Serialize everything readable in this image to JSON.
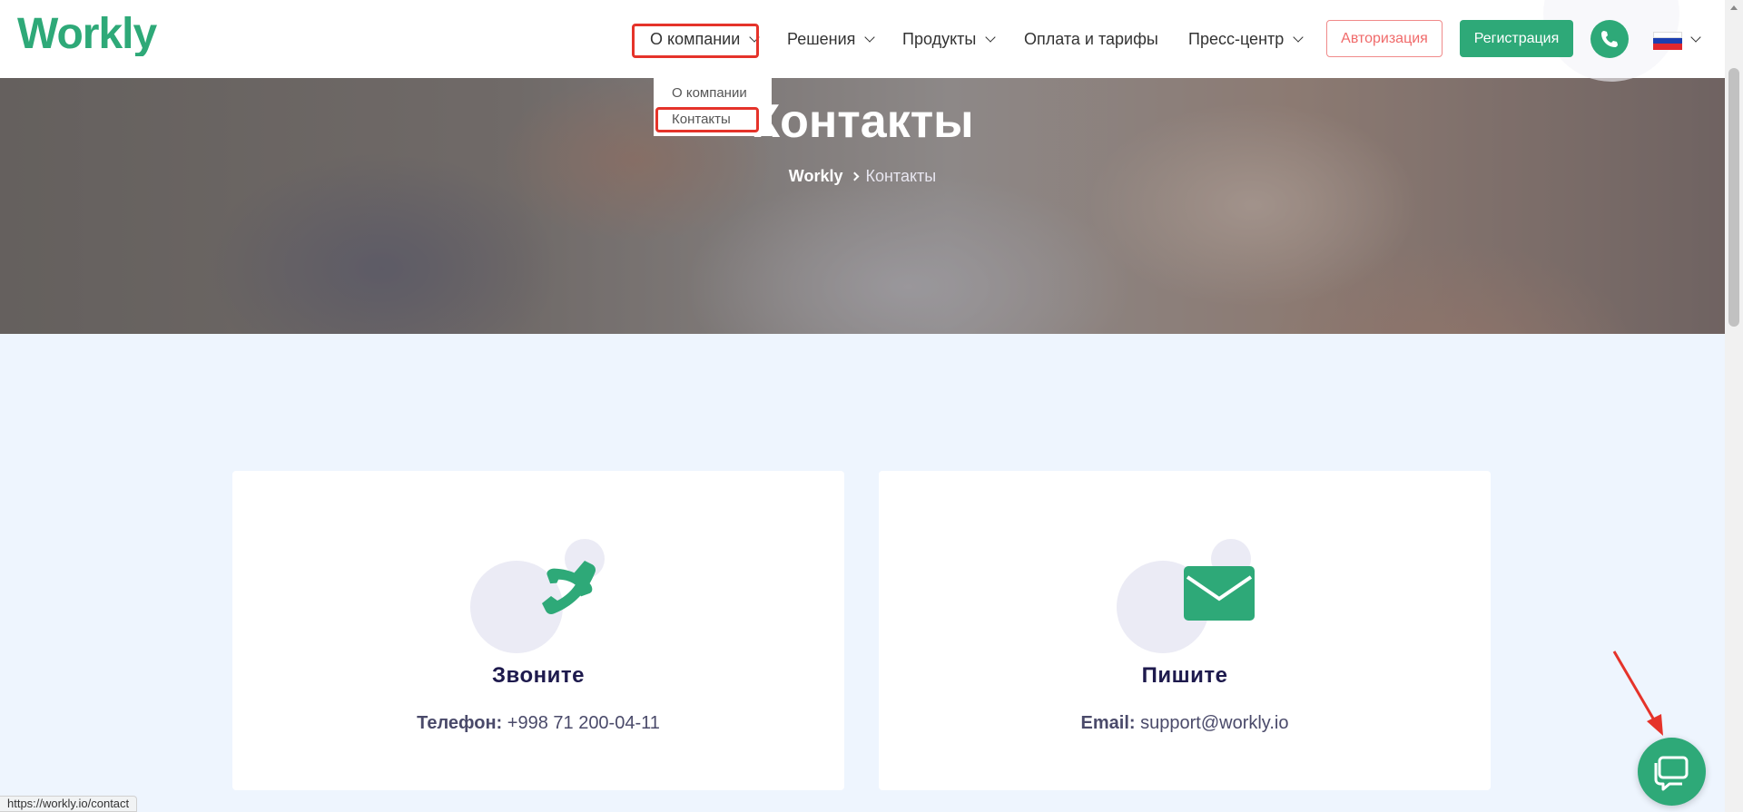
{
  "header": {
    "logo_text": "Workly",
    "nav": [
      {
        "label": "О компании",
        "has_dropdown": true
      },
      {
        "label": "Решения",
        "has_dropdown": true
      },
      {
        "label": "Продукты",
        "has_dropdown": true
      },
      {
        "label": "Оплата и тарифы",
        "has_dropdown": false
      },
      {
        "label": "Пресс-центр",
        "has_dropdown": true
      }
    ],
    "login_label": "Авторизация",
    "register_label": "Регистрация",
    "language": "ru",
    "icons": {
      "phone": "phone-icon",
      "flag": "russia-flag-icon",
      "chevron": "chevron-down-icon"
    }
  },
  "dropdown": {
    "items": [
      "О компании",
      "Контакты"
    ]
  },
  "hero": {
    "title": "Контакты",
    "breadcrumb": {
      "home": "Workly",
      "current": "Контакты"
    }
  },
  "cards": [
    {
      "title": "Звоните",
      "label": "Телефон:",
      "value": "+998 71 200-04-11",
      "icon": "phone-icon"
    },
    {
      "title": "Пишите",
      "label": "Email:",
      "value": "support@workly.io",
      "icon": "envelope-icon"
    }
  ],
  "status_bar": {
    "url": "https://workly.io/contact"
  },
  "colors": {
    "brand": "#2ea978",
    "highlight": "#e5332a",
    "title": "#1e1a4d",
    "login": "#f06a6a"
  }
}
